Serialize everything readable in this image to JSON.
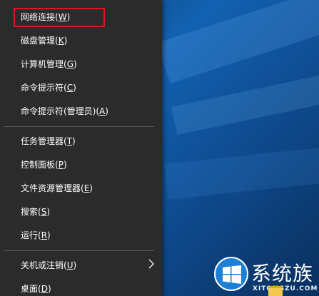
{
  "menu": {
    "items": [
      {
        "text": "网络连接(",
        "key": "W",
        "end": ")"
      },
      {
        "text": "磁盘管理(",
        "key": "K",
        "end": ")"
      },
      {
        "text": "计算机管理(",
        "key": "G",
        "end": ")"
      },
      {
        "text": "命令提示符(",
        "key": "C",
        "end": ")"
      },
      {
        "text": "命令提示符(管理员)(",
        "key": "A",
        "end": ")"
      },
      {
        "text": "任务管理器(",
        "key": "T",
        "end": ")"
      },
      {
        "text": "控制面板(",
        "key": "P",
        "end": ")"
      },
      {
        "text": "文件资源管理器(",
        "key": "E",
        "end": ")"
      },
      {
        "text": "搜索(",
        "key": "S",
        "end": ")"
      },
      {
        "text": "运行(",
        "key": "R",
        "end": ")"
      },
      {
        "text": "关机或注销(",
        "key": "U",
        "end": ")"
      },
      {
        "text": "桌面(",
        "key": "D",
        "end": ")"
      }
    ],
    "highlighted_item": "网络连接(W)",
    "highlight_color": "#e0141c",
    "background_color": "#2b2b2b",
    "text_color": "#ffffff"
  },
  "icons": {
    "submenu_arrow": "chevron-right-icon",
    "watermark_logo": "windows-logo-icon",
    "taskbar_folder": "folder-icon"
  },
  "watermark": {
    "title": "系统族",
    "subtitle": "XITONGZU.COM"
  }
}
